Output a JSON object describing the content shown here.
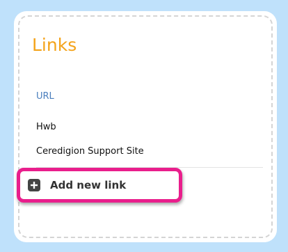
{
  "panel": {
    "title": "Links",
    "url_label": "URL",
    "links": [
      {
        "label": "Hwb"
      },
      {
        "label": "Ceredigion Support Site"
      }
    ],
    "add_button": {
      "label": "Add new link",
      "icon": "plus-square-icon"
    }
  },
  "colors": {
    "page_background": "#bfe1fb",
    "title": "#f4a31a",
    "url_label": "#4a7ebd",
    "highlight": "#e91e8c",
    "icon": "#444444"
  }
}
